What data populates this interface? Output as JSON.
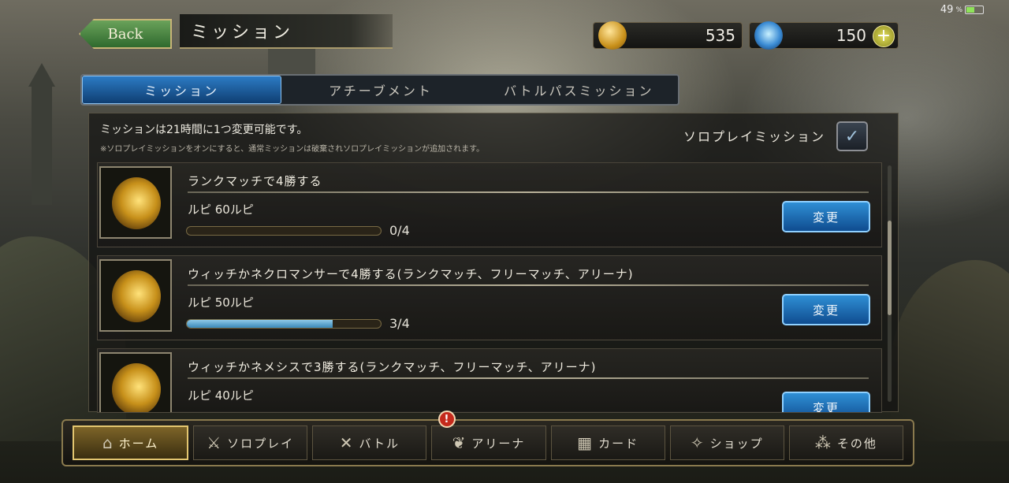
{
  "status": {
    "battery": "49"
  },
  "header": {
    "back_label": "Back",
    "title": "ミッション",
    "gold_amount": "535",
    "crystal_amount": "150",
    "plus_label": "+"
  },
  "tabs": [
    {
      "label": "ミッション",
      "active": true
    },
    {
      "label": "アチーブメント",
      "active": false
    },
    {
      "label": "バトルパスミッション",
      "active": false
    }
  ],
  "panel": {
    "notice": "ミッションは21時間に1つ変更可能です。",
    "notice_sub": "※ソロプレイミッションをオンにすると、通常ミッションは破棄されソロプレイミッションが追加されます。",
    "solo_label": "ソロプレイミッション"
  },
  "missions": [
    {
      "title": "ランクマッチで4勝する",
      "reward": "ルピ 60ルピ",
      "progress": 0.0,
      "count": "0/4",
      "button": "変更"
    },
    {
      "title": "ウィッチかネクロマンサーで4勝する(ランクマッチ、フリーマッチ、アリーナ)",
      "reward": "ルピ 50ルピ",
      "progress": 0.75,
      "count": "3/4",
      "button": "変更"
    },
    {
      "title": "ウィッチかネメシスで3勝する(ランクマッチ、フリーマッチ、アリーナ)",
      "reward": "ルピ 40ルピ",
      "button": "変更"
    }
  ],
  "nav": [
    {
      "label": "ホーム",
      "icon": "home-icon",
      "active": true
    },
    {
      "label": "ソロプレイ",
      "icon": "sword-icon"
    },
    {
      "label": "バトル",
      "icon": "crossed-swords-icon"
    },
    {
      "label": "アリーナ",
      "icon": "laurel-icon",
      "alert": "!"
    },
    {
      "label": "カード",
      "icon": "cards-icon"
    },
    {
      "label": "ショップ",
      "icon": "shop-icon"
    },
    {
      "label": "その他",
      "icon": "more-icon"
    }
  ]
}
